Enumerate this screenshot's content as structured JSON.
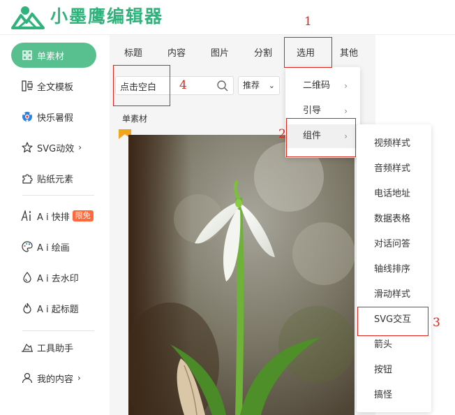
{
  "header": {
    "logo_text": "小墨鹰编辑器"
  },
  "sidebar": {
    "items": [
      {
        "label": "单素材",
        "icon": "grid-icon"
      },
      {
        "label": "全文模板",
        "icon": "template-icon"
      },
      {
        "label": "快乐暑假",
        "icon": "soccer-ball-icon"
      },
      {
        "label": "SVG动效",
        "icon": "star-icon"
      },
      {
        "label": "贴纸元素",
        "icon": "puzzle-icon"
      },
      {
        "label": "A i 快排",
        "icon": "ai-icon",
        "badge": "限免"
      },
      {
        "label": "A i 绘画",
        "icon": "palette-icon"
      },
      {
        "label": "A i 去水印",
        "icon": "drop-icon"
      },
      {
        "label": "A i 起标题",
        "icon": "flame-icon"
      },
      {
        "label": "工具助手",
        "icon": "tools-icon"
      },
      {
        "label": "我的内容",
        "icon": "user-icon"
      }
    ],
    "chevron": "›"
  },
  "tabs": [
    "标题",
    "内容",
    "图片",
    "分割",
    "选用",
    "其他"
  ],
  "search": {
    "value": "点击空白",
    "placeholder": ""
  },
  "sort": {
    "label": "推荐"
  },
  "section_label": "单素材",
  "menu1": {
    "items": [
      "二维码",
      "引导",
      "组件"
    ],
    "chevron": "›"
  },
  "menu2": {
    "items": [
      "视频样式",
      "音频样式",
      "电话地址",
      "数据表格",
      "对话问答",
      "轴线排序",
      "滑动样式",
      "SVG交互",
      "箭头",
      "按钮",
      "搞怪"
    ]
  },
  "annotations": {
    "n1": "1",
    "n2": "2",
    "n3": "3",
    "n4": "4"
  },
  "colors": {
    "brand": "#2fb27b",
    "active": "#58c08f",
    "badge": "#ff6a3c",
    "annotation": "#e0211a"
  }
}
